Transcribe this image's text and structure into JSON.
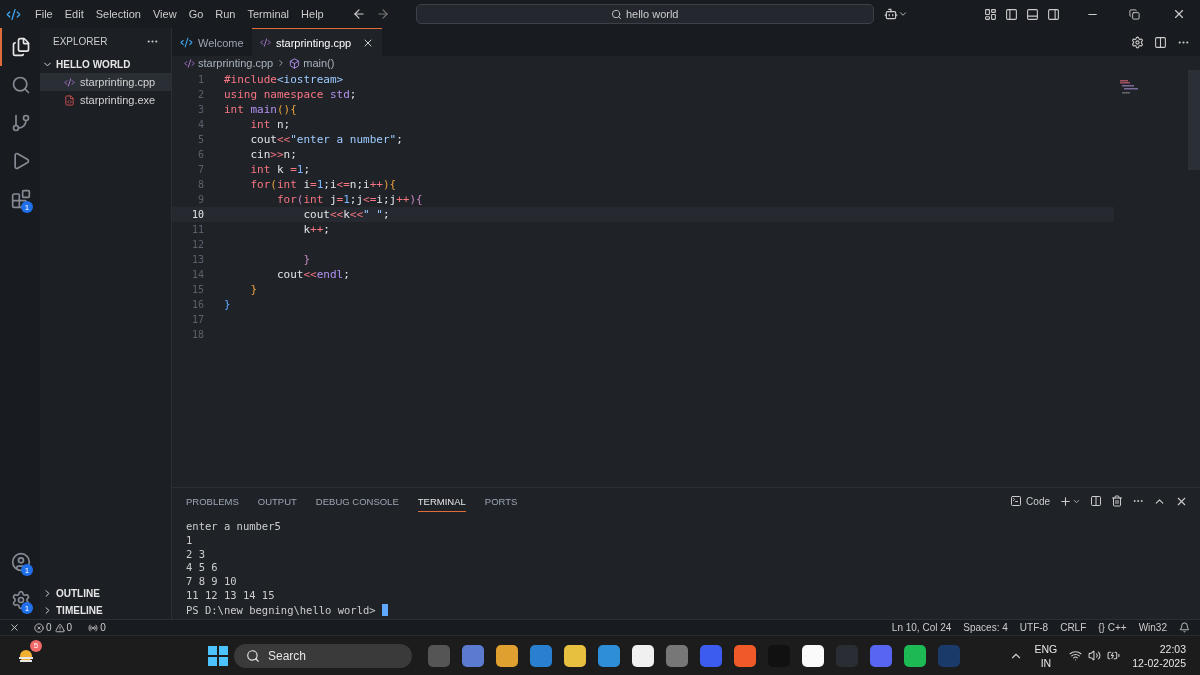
{
  "menu": [
    "File",
    "Edit",
    "Selection",
    "View",
    "Go",
    "Run",
    "Terminal",
    "Help"
  ],
  "command_center": {
    "value": "hello world"
  },
  "activity_badges": {
    "extensions": "1",
    "accounts": "1",
    "manage": "1"
  },
  "sidebar": {
    "title": "EXPLORER",
    "folder": "HELLO WORLD",
    "expanded": true,
    "files": [
      {
        "name": "starprinting.cpp",
        "kind": "cpp",
        "selected": true
      },
      {
        "name": "starprinting.exe",
        "kind": "exe",
        "selected": false
      }
    ],
    "sections": [
      "OUTLINE",
      "TIMELINE"
    ]
  },
  "tabs": [
    {
      "label": "Welcome",
      "kind": "welcome",
      "selected": false
    },
    {
      "label": "starprinting.cpp",
      "kind": "cpp",
      "selected": true
    }
  ],
  "breadcrumb": {
    "file": "starprinting.cpp",
    "symbol": "main()"
  },
  "lines": [
    {
      "number": "1",
      "current": false,
      "tokens": [
        {
          "kind": "preproc",
          "text": "#include"
        },
        {
          "kind": "header",
          "text": "<iostream>"
        }
      ]
    },
    {
      "number": "2",
      "current": false,
      "tokens": [
        {
          "kind": "keyword",
          "text": "using "
        },
        {
          "kind": "keyword",
          "text": "namespace "
        },
        {
          "kind": "type",
          "text": "std"
        },
        {
          "kind": "plain",
          "text": ";"
        }
      ]
    },
    {
      "number": "3",
      "current": false,
      "tokens": [
        {
          "kind": "keyword",
          "text": "int "
        },
        {
          "kind": "func",
          "text": "main"
        },
        {
          "kind": "bracket",
          "text": "(){"
        }
      ]
    },
    {
      "number": "4",
      "current": false,
      "tokens": [
        {
          "kind": "keyword",
          "text": "    int "
        },
        {
          "kind": "plain",
          "text": "n;"
        }
      ]
    },
    {
      "number": "5",
      "current": false,
      "tokens": [
        {
          "kind": "plain",
          "text": "    cout"
        },
        {
          "kind": "op",
          "text": "<<"
        },
        {
          "kind": "string",
          "text": "\"enter a number\""
        },
        {
          "kind": "plain",
          "text": ";"
        }
      ]
    },
    {
      "number": "6",
      "current": false,
      "tokens": [
        {
          "kind": "plain",
          "text": "    cin"
        },
        {
          "kind": "op",
          "text": ">>"
        },
        {
          "kind": "plain",
          "text": "n;"
        }
      ]
    },
    {
      "number": "7",
      "current": false,
      "tokens": [
        {
          "kind": "keyword",
          "text": "    int "
        },
        {
          "kind": "plain",
          "text": "k "
        },
        {
          "kind": "op",
          "text": "="
        },
        {
          "kind": "number",
          "text": "1"
        },
        {
          "kind": "plain",
          "text": ";"
        }
      ]
    },
    {
      "number": "8",
      "current": false,
      "tokens": [
        {
          "kind": "keyword",
          "text": "    for"
        },
        {
          "kind": "bracket",
          "text": "("
        },
        {
          "kind": "keyword",
          "text": "int "
        },
        {
          "kind": "plain",
          "text": "i"
        },
        {
          "kind": "op",
          "text": "="
        },
        {
          "kind": "number",
          "text": "1"
        },
        {
          "kind": "plain",
          "text": ";i"
        },
        {
          "kind": "op",
          "text": "<="
        },
        {
          "kind": "plain",
          "text": "n;i"
        },
        {
          "kind": "op",
          "text": "++"
        },
        {
          "kind": "bracket",
          "text": "){"
        }
      ]
    },
    {
      "number": "9",
      "current": false,
      "tokens": [
        {
          "kind": "keyword",
          "text": "        for"
        },
        {
          "kind": "bracket2",
          "text": "("
        },
        {
          "kind": "keyword",
          "text": "int "
        },
        {
          "kind": "plain",
          "text": "j"
        },
        {
          "kind": "op",
          "text": "="
        },
        {
          "kind": "number",
          "text": "1"
        },
        {
          "kind": "plain",
          "text": ";j"
        },
        {
          "kind": "op",
          "text": "<="
        },
        {
          "kind": "plain",
          "text": "i;j"
        },
        {
          "kind": "op",
          "text": "++"
        },
        {
          "kind": "bracket2",
          "text": "){"
        }
      ]
    },
    {
      "number": "10",
      "current": true,
      "tokens": [
        {
          "kind": "plain",
          "text": "            cout"
        },
        {
          "kind": "op",
          "text": "<<"
        },
        {
          "kind": "plain",
          "text": "k"
        },
        {
          "kind": "op",
          "text": "<<"
        },
        {
          "kind": "string",
          "text": "\" \""
        },
        {
          "kind": "plain",
          "text": ";"
        }
      ]
    },
    {
      "number": "11",
      "current": false,
      "tokens": [
        {
          "kind": "plain",
          "text": "            k"
        },
        {
          "kind": "op",
          "text": "++"
        },
        {
          "kind": "plain",
          "text": ";"
        }
      ]
    },
    {
      "number": "12",
      "current": false
    },
    {
      "number": "13",
      "current": false,
      "tokens": [
        {
          "kind": "bracket2",
          "text": "            }"
        }
      ]
    },
    {
      "number": "14",
      "current": false,
      "tokens": [
        {
          "kind": "plain",
          "text": "        cout"
        },
        {
          "kind": "op",
          "text": "<<"
        },
        {
          "kind": "func",
          "text": "endl"
        },
        {
          "kind": "plain",
          "text": ";"
        }
      ]
    },
    {
      "number": "15",
      "current": false,
      "tokens": [
        {
          "kind": "bracket",
          "text": "    }"
        }
      ]
    },
    {
      "number": "16",
      "current": false,
      "tokens": [
        {
          "kind": "bracket3",
          "text": "}"
        }
      ]
    },
    {
      "number": "17",
      "current": false
    },
    {
      "number": "18",
      "current": false
    }
  ],
  "panel": {
    "tabs": [
      {
        "label": "PROBLEMS",
        "selected": false
      },
      {
        "label": "OUTPUT",
        "selected": false
      },
      {
        "label": "DEBUG CONSOLE",
        "selected": false
      },
      {
        "label": "TERMINAL",
        "selected": true
      },
      {
        "label": "PORTS",
        "selected": false
      }
    ],
    "shell": "Code",
    "terminal": [
      "enter a number5",
      "1",
      "2 3",
      "4 5 6",
      "7 8 9 10",
      "11 12 13 14 15"
    ],
    "prompt": "PS D:\\new begning\\hello world> "
  },
  "status": {
    "errors": "0",
    "warnings": "0",
    "ports": "0",
    "right": [
      "Ln 10, Col 24",
      "Spaces: 4",
      "UTF-8",
      "CRLF",
      "{} C++",
      "Win32"
    ]
  },
  "taskbar": {
    "weather_badge": "5",
    "search": "Search",
    "lang": "ENG",
    "region": "IN",
    "time": "22:03",
    "date": "12-02-2025"
  }
}
